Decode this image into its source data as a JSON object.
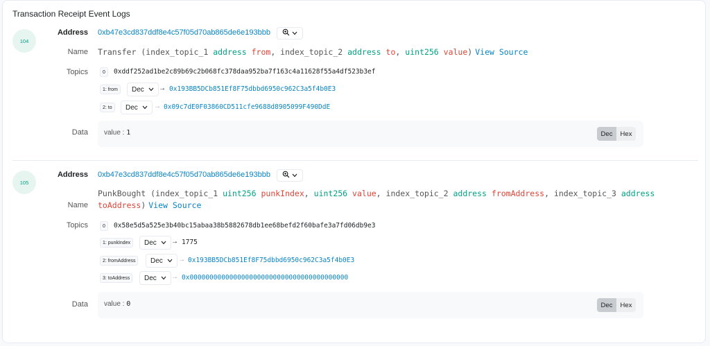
{
  "title": "Transaction Receipt Event Logs",
  "labels": {
    "address": "Address",
    "name": "Name",
    "topics": "Topics",
    "data": "Data",
    "dec_button": "Dec",
    "hex_button": "Hex",
    "view_source": "View Source"
  },
  "logs": [
    {
      "index": "104",
      "address": "0xb47e3cd837ddf8e4c57f05d70ab865de6e193bbb",
      "name": {
        "event": "Transfer",
        "params": [
          {
            "prefix": "index_topic_1",
            "type": "address",
            "name": "from"
          },
          {
            "prefix": "index_topic_2",
            "type": "address",
            "name": "to"
          },
          {
            "prefix": "",
            "type": "uint256",
            "name": "value"
          }
        ]
      },
      "topic0": {
        "index": "0",
        "value": "0xddf252ad1be2c89b69c2b068fc378daa952ba7f163c4a11628f55a4df523b3ef"
      },
      "topics": [
        {
          "index": "1: from",
          "format": "Dec",
          "value": "0x193BB5DCb851Ef8F75dbbd6950c962C3a5f4b0E3"
        },
        {
          "index": "2: to",
          "format": "Dec",
          "value": "0x09c7dE0F03860CD511cfe9688d8905099F490DdE"
        }
      ],
      "data": {
        "key": "value",
        "value": "1"
      }
    },
    {
      "index": "105",
      "address": "0xb47e3cd837ddf8e4c57f05d70ab865de6e193bbb",
      "name": {
        "event": "PunkBought",
        "params": [
          {
            "prefix": "index_topic_1",
            "type": "uint256",
            "name": "punkIndex"
          },
          {
            "prefix": "",
            "type": "uint256",
            "name": "value"
          },
          {
            "prefix": "index_topic_2",
            "type": "address",
            "name": "fromAddress"
          },
          {
            "prefix": "index_topic_3",
            "type": "address",
            "name": "toAddress"
          }
        ]
      },
      "topic0": {
        "index": "0",
        "value": "0x58e5d5a525e3b40bc15abaa38b5882678db1ee68befd2f60bafe3a7fd06db9e3"
      },
      "topics": [
        {
          "index": "1: punkIndex",
          "format": "Dec",
          "value": "1775"
        },
        {
          "index": "2: fromAddress",
          "format": "Dec",
          "value": "0x193BB5DCb851Ef8F75dbbd6950c962C3a5f4b0E3"
        },
        {
          "index": "3: toAddress",
          "format": "Dec",
          "value": "0x0000000000000000000000000000000000000000"
        }
      ],
      "data": {
        "key": "value",
        "value": "0"
      }
    }
  ]
}
